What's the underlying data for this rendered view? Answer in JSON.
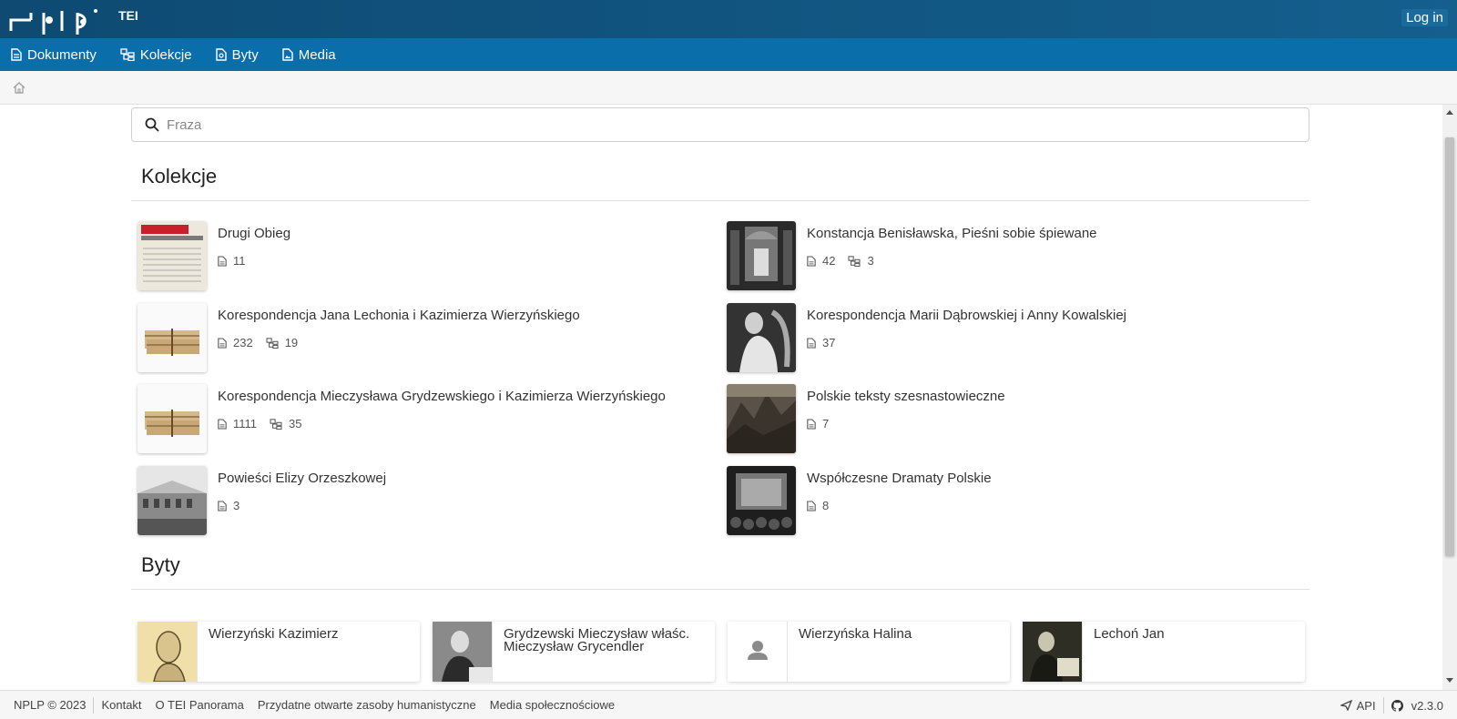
{
  "brand": {
    "logo_text": "nplp",
    "tei": "TEI"
  },
  "header": {
    "login_label": "Log in"
  },
  "nav": [
    {
      "label": "Dokumenty",
      "icon": "document-icon"
    },
    {
      "label": "Kolekcje",
      "icon": "collection-icon"
    },
    {
      "label": "Byty",
      "icon": "entity-icon"
    },
    {
      "label": "Media",
      "icon": "media-icon"
    }
  ],
  "search": {
    "placeholder": "Fraza",
    "value": ""
  },
  "collections_section": {
    "title": "Kolekcje",
    "items": [
      {
        "title": "Drugi Obieg",
        "documents": "11",
        "subcollections": ""
      },
      {
        "title": "Konstancja Benisławska, Pieśni sobie śpiewane",
        "documents": "42",
        "subcollections": "3"
      },
      {
        "title": "Korespondencja Jana Lechonia i Kazimierza Wierzyńskiego",
        "documents": "232",
        "subcollections": "19"
      },
      {
        "title": "Korespondencja Marii Dąbrowskiej i Anny Kowalskiej",
        "documents": "37",
        "subcollections": ""
      },
      {
        "title": "Korespondencja Mieczysława Grydzewskiego i Kazimierza Wierzyńskiego",
        "documents": "1111",
        "subcollections": "35"
      },
      {
        "title": "Polskie teksty szesnastowieczne",
        "documents": "7",
        "subcollections": ""
      },
      {
        "title": "Powieści Elizy Orzeszkowej",
        "documents": "3",
        "subcollections": ""
      },
      {
        "title": "Współczesne Dramaty Polskie",
        "documents": "8",
        "subcollections": ""
      }
    ]
  },
  "entities_section": {
    "title": "Byty",
    "items": [
      {
        "name_line1": "Wierzyński Kazimierz",
        "name_line2": ""
      },
      {
        "name_line1": "Grydzewski Mieczysław właśc.",
        "name_line2": "Mieczysław Grycendler"
      },
      {
        "name_line1": "Wierzyńska Halina",
        "name_line2": ""
      },
      {
        "name_line1": "Lechoń Jan",
        "name_line2": ""
      }
    ]
  },
  "footer": {
    "copyright": "NPLP © 2023",
    "links": [
      "Kontakt",
      "O TEI Panorama",
      "Przydatne otwarte zasoby humanistyczne",
      "Media społecznościowe"
    ],
    "api_label": "API",
    "version": "v2.3.0"
  },
  "colors": {
    "topbar": "#0e4a72",
    "navbar": "#0a6eaa",
    "text": "#333333"
  }
}
